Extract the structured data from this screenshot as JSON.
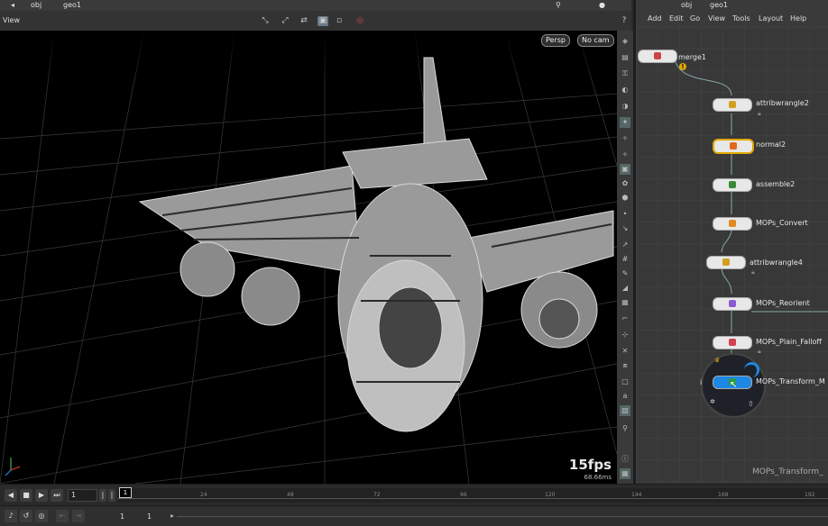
{
  "path_left": {
    "root": "obj",
    "node": "geo1"
  },
  "path_right": {
    "root": "obj",
    "node": "geo1"
  },
  "viewer": {
    "title": "View",
    "camera_persp": "Persp",
    "camera_cam": "No cam",
    "fps": "15fps",
    "ms": "68.66ms"
  },
  "network_menu": [
    "Add",
    "Edit",
    "Go",
    "View",
    "Tools",
    "Layout",
    "Help"
  ],
  "nodes": [
    {
      "name": "merge1"
    },
    {
      "name": "attribwrangle2"
    },
    {
      "name": "normal2"
    },
    {
      "name": "assemble2"
    },
    {
      "name": "MOPs_Convert"
    },
    {
      "name": "attribwrangle4"
    },
    {
      "name": "MOPs_Reorient"
    },
    {
      "name": "MOPs_Plain_Falloff"
    },
    {
      "name": "MOPs_Transform_M"
    }
  ],
  "footer_node_label": "MOPs_Transform_",
  "timeline": {
    "current_frame": "1",
    "marker": "1",
    "ticks": [
      "24",
      "48",
      "72",
      "96",
      "120",
      "144",
      "168",
      "192"
    ]
  },
  "bottom": {
    "start": "1",
    "end": "1"
  },
  "colors": {
    "selected_node_outline": "#e0a800",
    "accent_blue": "#1e88e5",
    "viewport_bg": "#000000"
  }
}
